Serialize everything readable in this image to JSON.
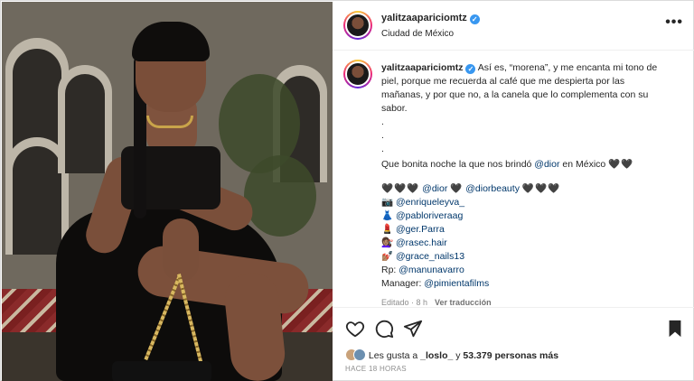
{
  "post": {
    "username": "yalitzaapariciomtz",
    "location": "Ciudad de México",
    "more_label": "•••"
  },
  "caption": {
    "username": "yalitzaapariciomtz",
    "line1": "Así es, “morena”, y me encanta mi tono de",
    "line2": "piel, porque me recuerda al café que me despierta por las",
    "line3": "mañanas, y por que no, a la canela que lo complementa con su",
    "line4": "sabor.",
    "dot": ".",
    "night_text": "Que bonita noche la que nos brindó",
    "night_tag": "@dior",
    "night_text2": "en México",
    "hearts2": "🖤🖤",
    "hearts3": "🖤🖤🖤",
    "dior_tag": "@dior",
    "heart1": "🖤",
    "diorbeauty_tag": "@diorbeauty",
    "credits": [
      {
        "emoji": "📷",
        "tag": "@enriqueleyva_"
      },
      {
        "emoji": "👗",
        "tag": "@pabloriveraag"
      },
      {
        "emoji": "💄",
        "tag": "@ger.Parra"
      },
      {
        "emoji": "💇🏽‍♀️",
        "tag": "@rasec.hair"
      },
      {
        "emoji": "💅🏽",
        "tag": "@grace_nails13"
      }
    ],
    "rp_label": "Rp:",
    "rp_tag": "@manunavarro",
    "manager_label": "Manager:",
    "manager_tag": "@pimientafilms",
    "edited": "Editado · 8 h",
    "translate": "Ver traducción"
  },
  "likes": {
    "prefix": "Les gusta a",
    "user": "_loslo_",
    "mid": "y",
    "count": "53.379 personas más"
  },
  "timestamp": "HACE 18 HORAS",
  "icons": [
    "heart-icon",
    "comment-icon",
    "share-icon",
    "bookmark-icon",
    "verified-badge-icon",
    "more-options-icon"
  ]
}
